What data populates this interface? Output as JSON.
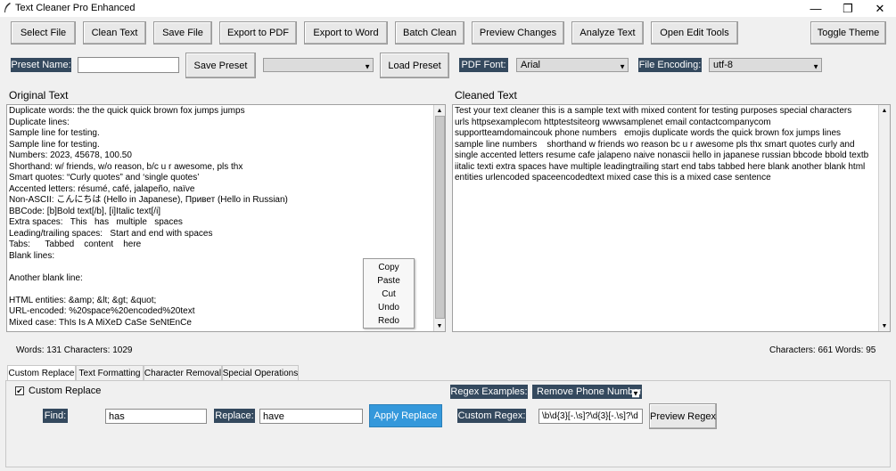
{
  "window": {
    "title": "Text Cleaner Pro Enhanced",
    "minimize": "—",
    "maximize": "❐",
    "close": "✕"
  },
  "toolbar": {
    "select_file": "Select File",
    "clean_text": "Clean Text",
    "save_file": "Save File",
    "export_pdf": "Export to PDF",
    "export_word": "Export to Word",
    "batch_clean": "Batch Clean",
    "preview_changes": "Preview Changes",
    "analyze_text": "Analyze Text",
    "open_edit_tools": "Open Edit Tools",
    "toggle_theme": "Toggle Theme"
  },
  "presets": {
    "preset_name_label": "Preset Name:",
    "preset_name_value": "",
    "save_preset": "Save Preset",
    "preset_select_value": "",
    "load_preset": "Load Preset",
    "pdf_font_label": "PDF Font:",
    "pdf_font_value": "Arial",
    "file_encoding_label": "File Encoding:",
    "file_encoding_value": "utf-8"
  },
  "original": {
    "heading": "Original Text",
    "lines": [
      "Duplicate words: the the quick quick brown fox jumps jumps",
      "Duplicate lines:",
      "Sample line for testing.",
      "Sample line for testing.",
      "Numbers: 2023, 45678, 100.50",
      "Shorthand: w/ friends, w/o reason, b/c u r awesome, pls thx",
      "Smart quotes: “Curly quotes” and ‘single quotes’",
      "Accented letters: résumé, café, jalapeño, naïve",
      "Non-ASCII: こんにちは (Hello in Japanese), Привет (Hello in Russian)",
      "BBCode: [b]Bold text[/b], [i]Italic text[/i]",
      "Extra spaces:   This   has   multiple   spaces",
      "Leading/trailing spaces:   Start and end with spaces",
      "Tabs:      Tabbed    content    here",
      "Blank lines:",
      "",
      "Another blank line:",
      "",
      "HTML entities: &amp; &lt; &gt; &quot;",
      "URL-encoded: %20space%20encoded%20text",
      "Mixed case: ThIs Is A MiXeD CaSe SeNtEnCe"
    ],
    "stats": "Words: 131  Characters: 1029"
  },
  "cleaned": {
    "heading": "Cleaned Text",
    "lines": [
      "Test your text cleaner this is a sample text with mixed content for testing purposes special characters",
      "urls httpsexamplecom httptestsiteorg wwwsamplenet email contactcompanycom",
      "supportteamdomaincouk phone numbers   emojis duplicate words the quick brown fox jumps lines",
      "sample line numbers    shorthand w friends wo reason bc u r awesome pls thx smart quotes curly and",
      "single accented letters resume cafe jalapeno naive nonascii hello in japanese russian bbcode bbold textb",
      "iitalic texti extra spaces have multiple leadingtrailing start end tabs tabbed here blank another blank html",
      "entities urlencoded spaceencodedtext mixed case this is a mixed case sentence"
    ],
    "stats": "Characters: 661  Words: 95"
  },
  "context_menu": {
    "items": [
      "Copy",
      "Paste",
      "Cut",
      "Undo",
      "Redo"
    ]
  },
  "tabs": [
    "Custom Replace",
    "Text Formatting",
    "Character Removal",
    "Special Operations"
  ],
  "custom_replace": {
    "checkbox_label": "Custom Replace",
    "checked": true,
    "regex_examples_label": "Regex Examples:",
    "regex_examples_value": "Remove Phone Numbers",
    "find_label": "Find:",
    "find_value": "has",
    "replace_label": "Replace:",
    "replace_value": "have",
    "apply_replace": "Apply Replace",
    "custom_regex_label": "Custom Regex:",
    "custom_regex_value": "\\b\\d{3}[-.\\s]?\\d{3}[-.\\s]?\\d",
    "preview_regex": "Preview Regex"
  },
  "colors": {
    "dark_label_bg": "#34495e",
    "apply_button_bg": "#3498db"
  }
}
